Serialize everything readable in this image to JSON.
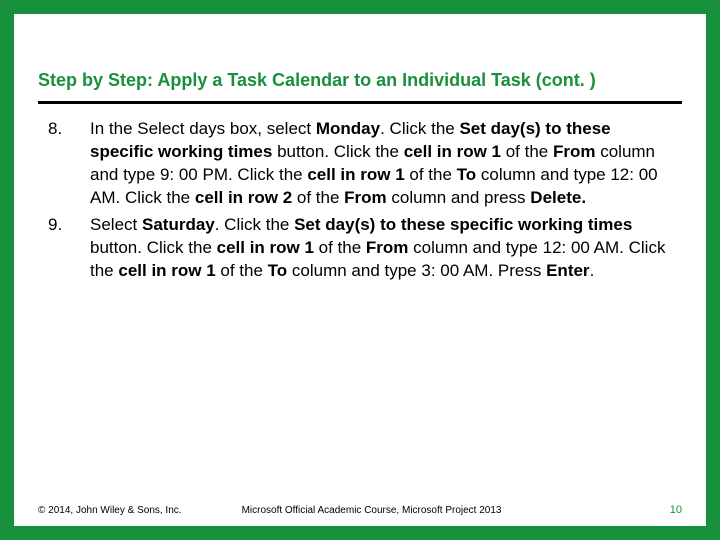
{
  "title": "Step by Step: Apply a Task Calendar to an Individual Task (cont. )",
  "steps": [
    {
      "segments": [
        {
          "t": "In the Select days box, select "
        },
        {
          "t": "Monday",
          "b": true
        },
        {
          "t": ". Click the "
        },
        {
          "t": "Set day(s) to these specific working times",
          "b": true
        },
        {
          "t": " button. Click the "
        },
        {
          "t": "cell in row 1",
          "b": true
        },
        {
          "t": " of the "
        },
        {
          "t": "From",
          "b": true
        },
        {
          "t": " column and type 9: 00 PM. Click the "
        },
        {
          "t": "cell in row 1",
          "b": true
        },
        {
          "t": " of the "
        },
        {
          "t": "To",
          "b": true
        },
        {
          "t": " column and type 12: 00 AM. Click the "
        },
        {
          "t": "cell in row 2",
          "b": true
        },
        {
          "t": " of the "
        },
        {
          "t": "From",
          "b": true
        },
        {
          "t": " column and press "
        },
        {
          "t": "Delete.",
          "b": true
        }
      ]
    },
    {
      "segments": [
        {
          "t": "Select "
        },
        {
          "t": "Saturday",
          "b": true
        },
        {
          "t": ". Click the "
        },
        {
          "t": "Set day(s) to these specific working times",
          "b": true
        },
        {
          "t": " button. Click the "
        },
        {
          "t": "cell in row 1",
          "b": true
        },
        {
          "t": " of the "
        },
        {
          "t": "From",
          "b": true
        },
        {
          "t": " column and type 12: 00 AM. Click the "
        },
        {
          "t": "cell in row 1",
          "b": true
        },
        {
          "t": " of the "
        },
        {
          "t": "To",
          "b": true
        },
        {
          "t": " column and type 3: 00 AM. Press "
        },
        {
          "t": "Enter",
          "b": true
        },
        {
          "t": "."
        }
      ]
    }
  ],
  "footer": {
    "copyright": "© 2014, John Wiley & Sons, Inc.",
    "course": "Microsoft Official Academic Course, Microsoft Project 2013",
    "page": "10"
  }
}
